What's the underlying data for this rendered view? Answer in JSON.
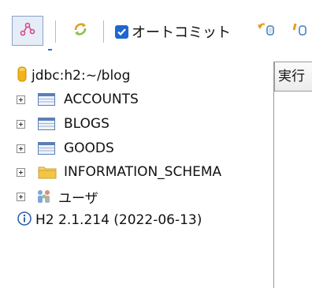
{
  "toolbar": {
    "autocommit_label": "オートコミット",
    "autocommit_checked": true
  },
  "tree": {
    "connection": "jdbc:h2:~/blog",
    "tables": [
      "ACCOUNTS",
      "BLOGS",
      "GOODS"
    ],
    "schema": "INFORMATION_SCHEMA",
    "users": "ユーザ",
    "version": "H2 2.1.214 (2022-06-13)"
  },
  "panel": {
    "execute_label": "実行"
  },
  "colors": {
    "accent": "#1e66d0",
    "separator": "#b9b9b9",
    "table_icon": "#5b7fb6",
    "folder_icon": "#f4c542",
    "db_icon": "#f2b31b"
  }
}
